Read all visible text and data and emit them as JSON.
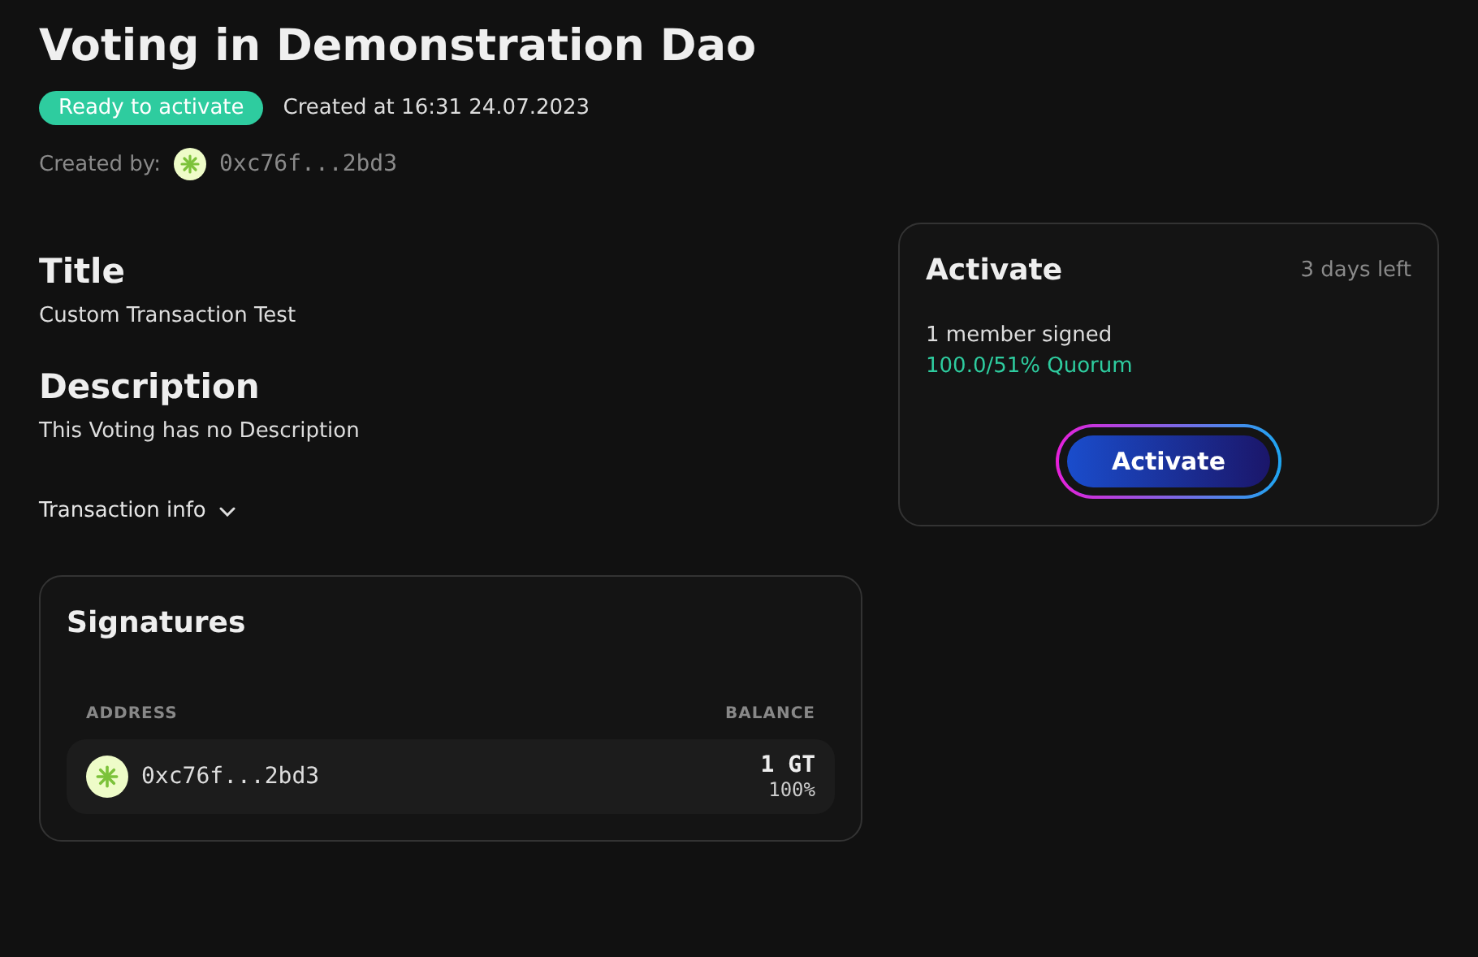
{
  "header": {
    "title": "Voting in Demonstration Dao",
    "status": {
      "kind": "ready",
      "label": "Ready to activate"
    },
    "created_at": "Created at 16:31 24.07.2023",
    "created_by_label": "Created by:",
    "creator_address": "0xc76f...2bd3"
  },
  "details": {
    "title_heading": "Title",
    "title_text": "Custom Transaction Test",
    "description_heading": "Description",
    "description_text": "This Voting has no Description",
    "transaction_info": {
      "label": "Transaction info",
      "expanded": false
    }
  },
  "signatures": {
    "heading": "Signatures",
    "columns": [
      "ADDRESS",
      "BALANCE"
    ],
    "rows": [
      {
        "address": "0xc76f...2bd3",
        "balance": "1 GT",
        "share": "100%"
      }
    ]
  },
  "activate_card": {
    "heading": "Activate",
    "time_left": "3 days left",
    "signed": "1 member signed",
    "quorum": "100.0/51% Quorum",
    "button": "Activate"
  }
}
